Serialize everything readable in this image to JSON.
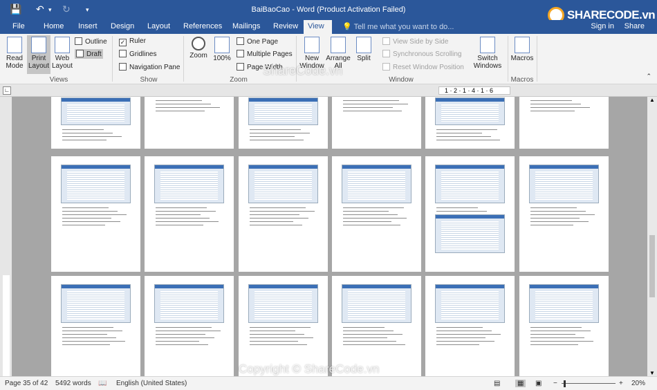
{
  "window": {
    "title": "BaiBaoCao - Word (Product Activation Failed)",
    "sign_in": "Sign in",
    "share": "Share"
  },
  "logo": {
    "text": "SHARECODE.vn"
  },
  "tabs": [
    "File",
    "Home",
    "Insert",
    "Design",
    "Layout",
    "References",
    "Mailings",
    "Review",
    "View"
  ],
  "tell_me": "Tell me what you want to do...",
  "ribbon": {
    "views": {
      "read_mode": "Read Mode",
      "print_layout": "Print Layout",
      "web_layout": "Web Layout",
      "outline": "Outline",
      "draft": "Draft",
      "group": "Views"
    },
    "show": {
      "ruler": "Ruler",
      "gridlines": "Gridlines",
      "nav_pane": "Navigation Pane",
      "group": "Show"
    },
    "zoom": {
      "zoom": "Zoom",
      "hundred": "100%",
      "one_page": "One Page",
      "multiple_pages": "Multiple Pages",
      "page_width": "Page Width",
      "group": "Zoom"
    },
    "window": {
      "new_window": "New Window",
      "arrange_all": "Arrange All",
      "split": "Split",
      "side_by_side": "View Side by Side",
      "sync_scroll": "Synchronous Scrolling",
      "reset_pos": "Reset Window Position",
      "switch_windows": "Switch Windows",
      "group": "Window"
    },
    "macros": {
      "macros": "Macros",
      "group": "Macros"
    }
  },
  "ruler": {
    "ticks": "1 · 2 · 1 · 4 · 1 · 6"
  },
  "status": {
    "page": "Page 35 of 42",
    "words": "5492 words",
    "language": "English (United States)",
    "zoom": "20%"
  },
  "watermarks": {
    "top": "ShareCode.vn",
    "bottom": "Copyright © ShareCode.vn"
  }
}
